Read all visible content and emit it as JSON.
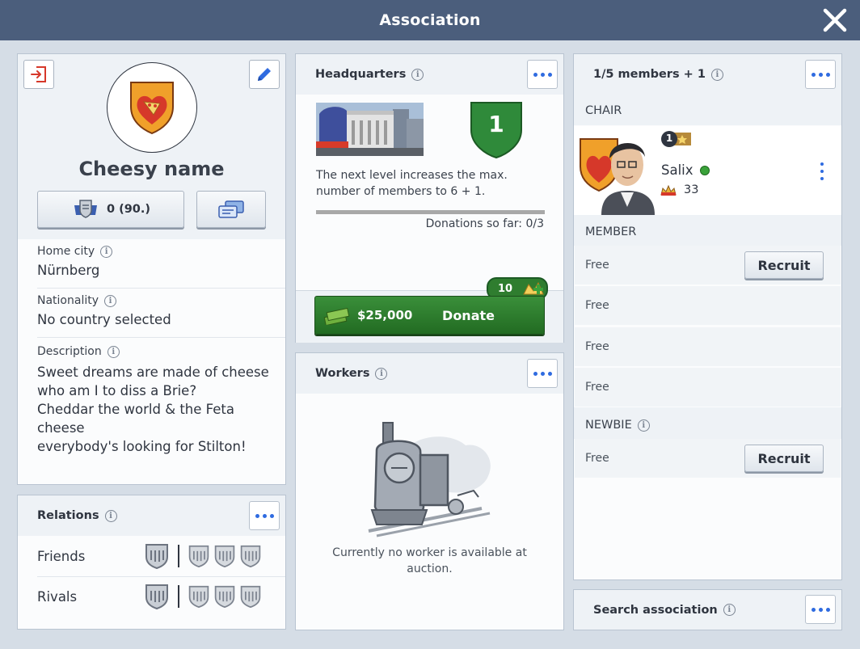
{
  "window": {
    "title": "Association"
  },
  "profile": {
    "name": "Cheesy name",
    "score_button": "0 (90.)",
    "home_city_label": "Home city",
    "home_city": "Nürnberg",
    "nationality_label": "Nationality",
    "nationality": "No country selected",
    "description_label": "Description",
    "description_lines": [
      "Sweet dreams are made of cheese",
      "who am I to diss a Brie?",
      "Cheddar the world & the Feta cheese",
      "everybody's looking for Stilton!"
    ]
  },
  "relations": {
    "title": "Relations",
    "rows": [
      {
        "label": "Friends"
      },
      {
        "label": "Rivals"
      }
    ]
  },
  "headquarters": {
    "title": "Headquarters",
    "level": "1",
    "info": "The next level increases the max. number of members to 6 + 1.",
    "info_lines": [
      "The next level increases the max.",
      "number of members to 6 + 1."
    ],
    "donations_text": "Donations so far: 0/3",
    "donations_progress": 0,
    "bonus_badge": "10",
    "price": "$25,000",
    "donate_label": "Donate"
  },
  "workers": {
    "title": "Workers",
    "empty_lines": [
      "Currently no worker is available at",
      "auction."
    ]
  },
  "members": {
    "title": "1/5 members + 1",
    "chair_label": "CHAIR",
    "chair": {
      "name": "Salix",
      "rank": "1",
      "stat": "33",
      "online": true
    },
    "member_label": "MEMBER",
    "member_slots": [
      "Free",
      "Free",
      "Free",
      "Free"
    ],
    "recruit_label": "Recruit",
    "newbie_label": "NEWBIE",
    "newbie_slots": [
      "Free"
    ]
  },
  "search": {
    "title": "Search association"
  },
  "colors": {
    "titlebar": "#4b5e7c",
    "accent_blue": "#2f6be0",
    "donate_green": "#2f7d2f",
    "crest_orange": "#f0a02a",
    "crest_red": "#d6382a",
    "online_green": "#3aa23a"
  },
  "icons": {
    "close": "close-icon",
    "leave": "exit-icon",
    "edit": "pencil-icon",
    "score": "crest-score-icon",
    "messages": "messages-icon",
    "more": "more-dots-icon",
    "info": "info-icon",
    "money": "cash-stack-icon"
  }
}
